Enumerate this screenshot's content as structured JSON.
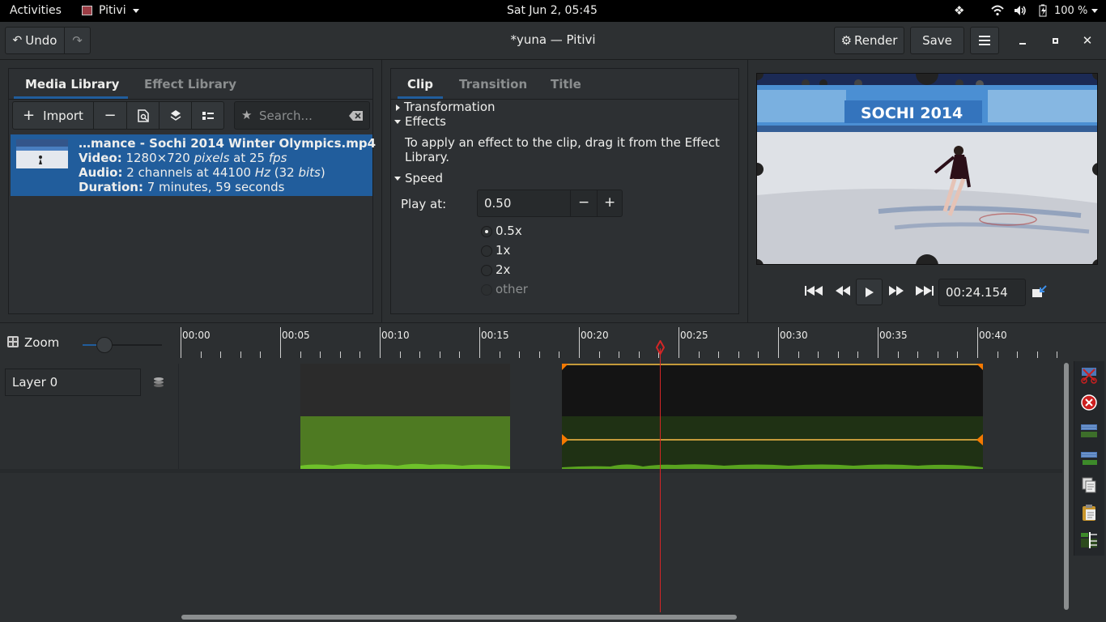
{
  "topbar": {
    "activities": "Activities",
    "app_name": "Pitivi",
    "clock": "Sat Jun  2, 05:45",
    "battery": "100 %"
  },
  "header": {
    "undo_label": "Undo",
    "title": "*yuna — Pitivi",
    "render_label": "Render",
    "save_label": "Save"
  },
  "library": {
    "tabs": [
      "Media Library",
      "Effect Library"
    ],
    "import_label": "Import",
    "search_placeholder": "Search...",
    "item": {
      "filename": "…mance - Sochi 2014 Winter Olympics.mp4",
      "video_key": "Video:",
      "video_res": " 1280×720 ",
      "video_px": "pixels",
      "video_at": " at 25 ",
      "video_fps": "fps",
      "audio_key": "Audio:",
      "audio_val": " 2 channels at 44100 ",
      "audio_hz": "Hz",
      "audio_bits": " (32 ",
      "audio_bits2": "bits",
      "audio_end": ")",
      "duration_key": "Duration:",
      "duration_val": " 7 minutes, 59 seconds"
    }
  },
  "clip_panel": {
    "tabs": [
      "Clip",
      "Transition",
      "Title"
    ],
    "transformation": "Transformation",
    "effects": "Effects",
    "effects_hint_1": "To apply an effect to the clip, drag it from the Effect",
    "effects_hint_2": "Library.",
    "speed": "Speed",
    "play_at_label": "Play at:",
    "play_at_value": "0.50",
    "speed_options": [
      "0.5x",
      "1x",
      "2x",
      "other"
    ],
    "selected_speed": "0.5x"
  },
  "viewer": {
    "banner_text": "SOCHI 2014",
    "timecode": "00:24.154"
  },
  "timeline": {
    "zoom_label": "Zoom",
    "layer_label": "Layer 0",
    "ruler_labels": [
      "00:00",
      "00:05",
      "00:10",
      "00:15",
      "00:20",
      "00:25",
      "00:30",
      "00:35",
      "00:40"
    ],
    "playhead_time": "00:24.154"
  },
  "colors": {
    "accent": "#215d9c",
    "audio_green": "#4e7a22",
    "playhead": "#d42626",
    "clip_border": "#f57900"
  }
}
